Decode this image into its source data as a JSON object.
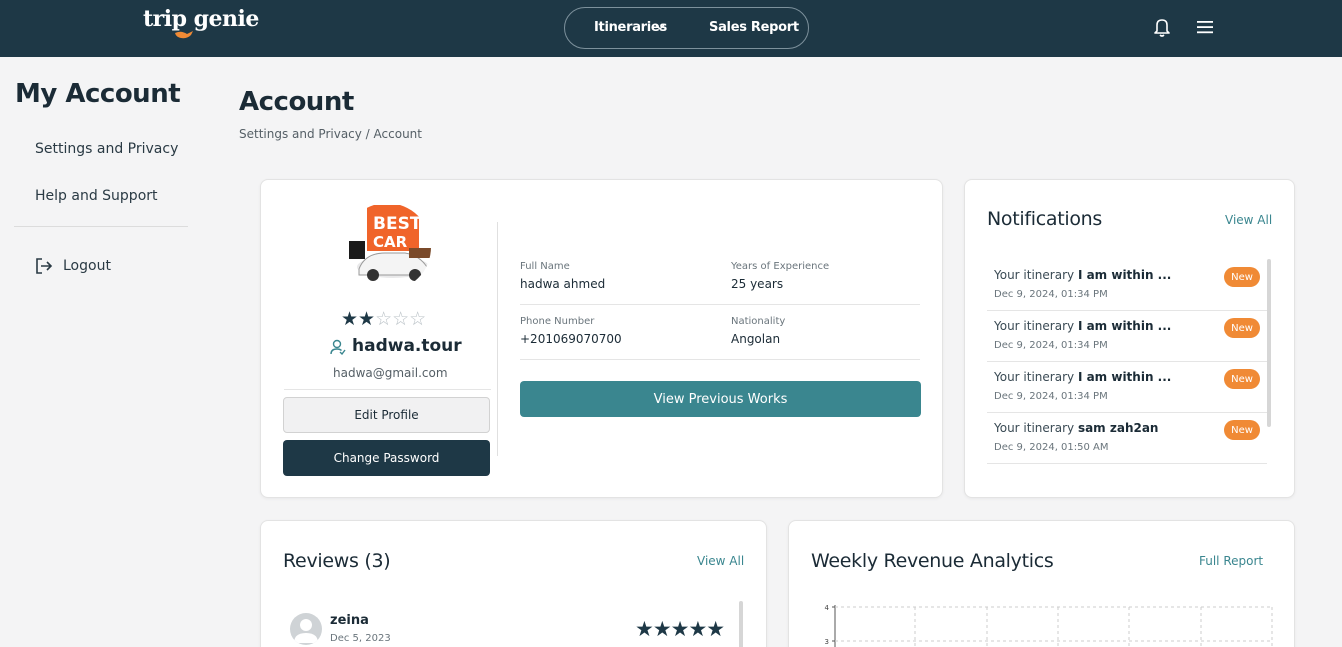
{
  "header": {
    "logo_text": "trip genie",
    "nav": {
      "itineraries": "Itineraries",
      "sales_report": "Sales Report"
    }
  },
  "sidebar": {
    "title": "My Account",
    "items": [
      {
        "label": "Settings and Privacy"
      },
      {
        "label": "Help and Support"
      }
    ],
    "logout": "Logout"
  },
  "page": {
    "title": "Account",
    "breadcrumb": "Settings and Privacy / Account"
  },
  "profile": {
    "rating": 2,
    "rating_max": 5,
    "username": "hadwa.tour",
    "email": "hadwa@gmail.com",
    "edit_label": "Edit Profile",
    "change_password_label": "Change Password",
    "fields": {
      "full_name_label": "Full Name",
      "full_name": "hadwa ahmed",
      "experience_label": "Years of Experience",
      "experience": "25 years",
      "phone_label": "Phone Number",
      "phone": "+201069070700",
      "nationality_label": "Nationality",
      "nationality": "Angolan"
    },
    "view_works_label": "View Previous Works"
  },
  "notifications": {
    "title": "Notifications",
    "view_all": "View All",
    "items": [
      {
        "prefix": "Your itinerary ",
        "subject": "I am within ...",
        "time": "Dec 9, 2024, 01:34 PM",
        "badge": "New"
      },
      {
        "prefix": "Your itinerary ",
        "subject": "I am within ...",
        "time": "Dec 9, 2024, 01:34 PM",
        "badge": "New"
      },
      {
        "prefix": "Your itinerary ",
        "subject": "I am within ...",
        "time": "Dec 9, 2024, 01:34 PM",
        "badge": "New"
      },
      {
        "prefix": "Your itinerary ",
        "subject": "sam zah2an",
        "time": "Dec 9, 2024, 01:50 AM",
        "badge": "New"
      }
    ]
  },
  "reviews": {
    "title": "Reviews (3)",
    "view_all": "View All",
    "items": [
      {
        "name": "zeina",
        "date": "Dec 5, 2023",
        "stars": 5
      }
    ]
  },
  "revenue": {
    "title": "Weekly Revenue Analytics",
    "full_report": "Full Report",
    "y_ticks": [
      "4",
      "3"
    ]
  },
  "colors": {
    "header_bg": "#1e3846",
    "accent_teal": "#3a868f",
    "badge_orange": "#f08a35"
  }
}
